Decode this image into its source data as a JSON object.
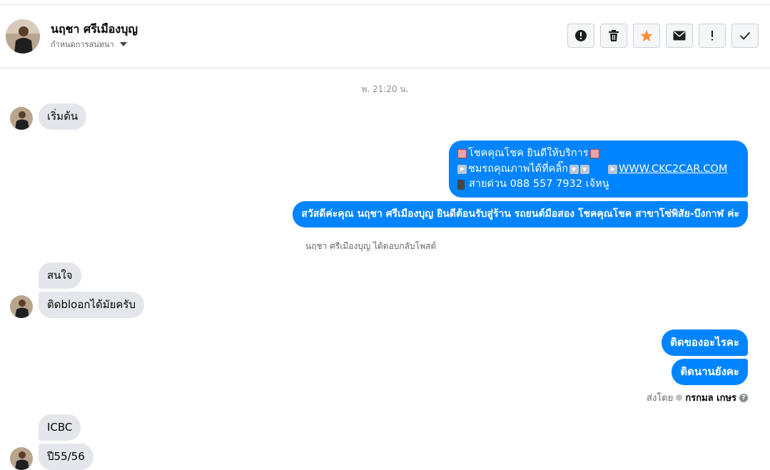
{
  "header": {
    "name": "นฤชา ศรีเมืองบุญ",
    "subtitle": "กำหนดการสนทนา",
    "actions": [
      "spam-icon",
      "trash-icon",
      "star-icon",
      "mail-icon",
      "alert-icon",
      "check-icon"
    ],
    "star_color": "#f7923b"
  },
  "thread": {
    "timestamp": "พ. 21:20 น.",
    "incoming_1": "เริ่มต้น",
    "outgoing_card": {
      "line1": "โชคคุณโชค ยินดีให้บริการ",
      "line2_text": "ชมรถคุณภาพได้ที่คลิ๊ก",
      "line2_link": "WWW.CKC2CAR.COM",
      "line3": "สายด่วน 088 557 7932 เจ้หนู"
    },
    "outgoing_greeting": "สวัสดีค่ะคุณ นฤชา ศรีเมืองบุญ ยินดีต้อนรับสู่ร้าน รถยนต์มือสอง โชคคุณโชค สาขาโซ่พิสัย-บึงกาฬ ค่ะ",
    "system_note": "นฤชา ศรีเมืองบุญ ได้ตอบกลับโพสต์",
    "incoming_2": "สนใจ",
    "incoming_3": "ติดbloอกได้มัยครับ",
    "outgoing_1": "ติดของอะไรคะ",
    "outgoing_2": "ติดนานยังคะ",
    "sent_by_label": "ส่งโดย",
    "sent_by_name": "กรกมล เกษร",
    "incoming_4": "ICBC",
    "incoming_5": "ปี55/56"
  },
  "colors": {
    "outgoing_bubble": "#0084ff",
    "incoming_bubble": "#e4e6eb"
  }
}
